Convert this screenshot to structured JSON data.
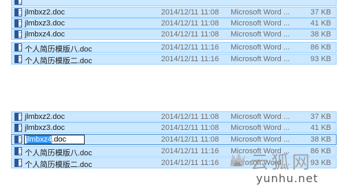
{
  "panel_top": {
    "rows": [
      {
        "name": "jlmbxz2.doc",
        "date": "2014/12/11 11:08",
        "type": "Microsoft Word ...",
        "size": "37 KB"
      },
      {
        "name": "jlmbxz3.doc",
        "date": "2014/12/11 11:08",
        "type": "Microsoft Word ...",
        "size": "41 KB"
      },
      {
        "name": "jlmbxz4.doc",
        "date": "2014/12/11 11:08",
        "type": "Microsoft Word ...",
        "size": "38 KB"
      },
      {
        "name": "个人简历模版八.doc",
        "date": "2014/12/11 11:16",
        "type": "Microsoft Word ...",
        "size": "86 KB"
      },
      {
        "name": "个人简历模版二.doc",
        "date": "2014/12/11 11:16",
        "type": "Microsoft Word ...",
        "size": "93 KB"
      }
    ]
  },
  "panel_bottom": {
    "rows": [
      {
        "name": "jlmbxz2.doc",
        "date": "2014/12/11 11:08",
        "type": "Microsoft Word ...",
        "size": "37 KB"
      },
      {
        "name": "jlmbxz3.doc",
        "date": "2014/12/11 11:08",
        "type": "Microsoft Word ...",
        "size": "41 KB"
      },
      {
        "name": "jlmbxz4.doc",
        "date": "2014/12/11 11:08",
        "type": "Microsoft Word ...",
        "size": "38 KB"
      },
      {
        "name": "个人简历模版八.doc",
        "date": "2014/12/11 11:16",
        "type": "Microsoft Word ...",
        "size": "86 KB"
      },
      {
        "name": "个人简历模版二.doc",
        "date": "2014/12/11 11:16",
        "type": "Microsoft Word ...",
        "size": "93 KB"
      }
    ],
    "rename": {
      "selected": "jlmbxz4",
      "ext": ".doc"
    }
  },
  "watermark": {
    "cn": "云狐网",
    "url": "yunhu.net"
  },
  "colors": {
    "selection": "#cce8ff",
    "selection_border": "#99d1ff",
    "word_blue": "#2b579a",
    "text_highlight": "#3399ff"
  }
}
